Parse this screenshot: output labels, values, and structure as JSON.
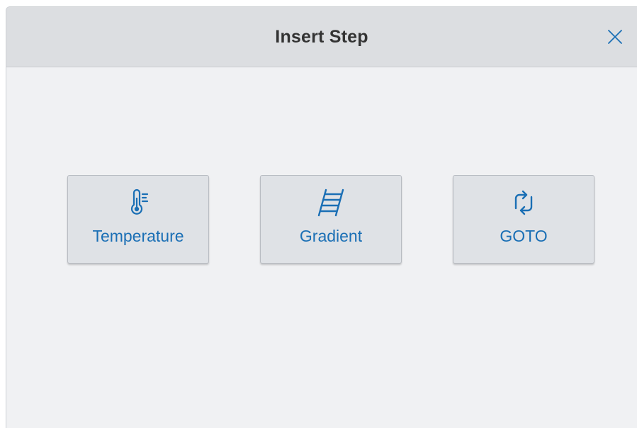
{
  "dialog": {
    "title": "Insert Step",
    "close_icon": "close-icon"
  },
  "steps": [
    {
      "label": "Temperature",
      "icon": "thermometer-icon"
    },
    {
      "label": "Gradient",
      "icon": "ladder-icon"
    },
    {
      "label": "GOTO",
      "icon": "loop-arrows-icon"
    }
  ],
  "colors": {
    "accent": "#1a6fb5",
    "header_bg": "#dcdee1",
    "body_bg": "#f0f1f3",
    "button_bg": "#dfe2e6",
    "title_text": "#333333",
    "close_icon": "#1a6fb5"
  }
}
